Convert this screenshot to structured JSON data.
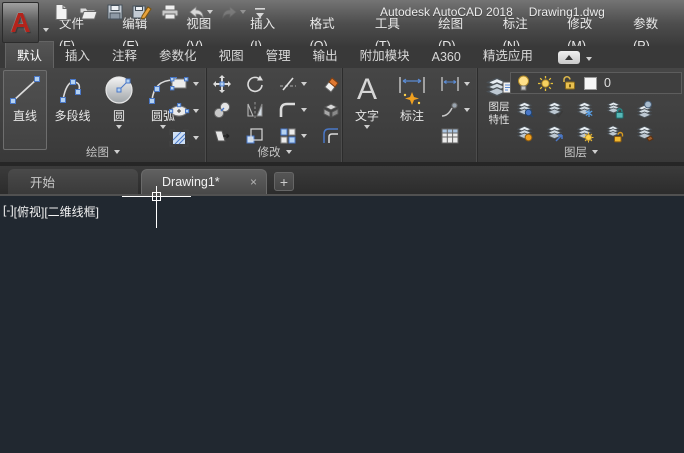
{
  "titlebar": {
    "app_title": "Autodesk AutoCAD 2018",
    "doc_title": "Drawing1.dwg",
    "logo_letter": "A"
  },
  "quick_access": {
    "icons": [
      "new-document",
      "open-file",
      "save",
      "save-as",
      "plot",
      "undo",
      "redo",
      "customize-quick-access"
    ]
  },
  "menubar": {
    "items": [
      "文件(F)",
      "编辑(E)",
      "视图(V)",
      "插入(I)",
      "格式(O)",
      "工具(T)",
      "绘图(D)",
      "标注(N)",
      "修改(M)",
      "参数(P)"
    ]
  },
  "ribbon": {
    "tabs": [
      "默认",
      "插入",
      "注释",
      "参数化",
      "视图",
      "管理",
      "输出",
      "附加模块",
      "A360",
      "精选应用"
    ],
    "active_tab": "默认"
  },
  "draw_panel": {
    "label": "绘图",
    "line": "直线",
    "polyline": "多段线",
    "circle": "圆",
    "arc": "圆弧",
    "mini_icons": [
      "rectangle",
      "ellipse",
      "hatch"
    ]
  },
  "modify_panel": {
    "label": "修改",
    "icons": [
      "move",
      "rotate",
      "trim",
      "erase",
      "copy",
      "mirror",
      "fillet",
      "explode",
      "stretch",
      "scale",
      "array",
      "offset"
    ]
  },
  "annotation_panel": {
    "text": "文字",
    "dimension": "标注",
    "mini_icons": [
      "linear-dimension",
      "leader",
      "table"
    ]
  },
  "layer_panel": {
    "label": "图层",
    "properties_line1": "图层",
    "properties_line2": "特性",
    "current_layer": "0",
    "combo_icons": [
      "layer-on-bulb",
      "layer-sun",
      "layer-unlock",
      "layer-color-swatch"
    ],
    "tool_icons": [
      "layer-isolate",
      "layer-make-current",
      "layer-freeze",
      "layer-lock",
      "layer-previous",
      "layer-unisolate",
      "layer-match",
      "layer-turn-all-on",
      "layer-unlock-tool",
      "layer-merge"
    ]
  },
  "file_tabs": {
    "start": "开始",
    "active": "Drawing1*",
    "close": "×",
    "new_tab": "+"
  },
  "viewport": {
    "control_minus": "[-]",
    "control_view": "[俯视]",
    "control_style": "[二维线框]"
  },
  "colors": {
    "canvas_bg": "#212830",
    "ribbon_bg": "#3f3f3f",
    "grip_blue": "#b4d2f2",
    "accent_blue": "#4a78c8",
    "logo_red": "#b3231b",
    "spark_orange": "#f0a020"
  }
}
